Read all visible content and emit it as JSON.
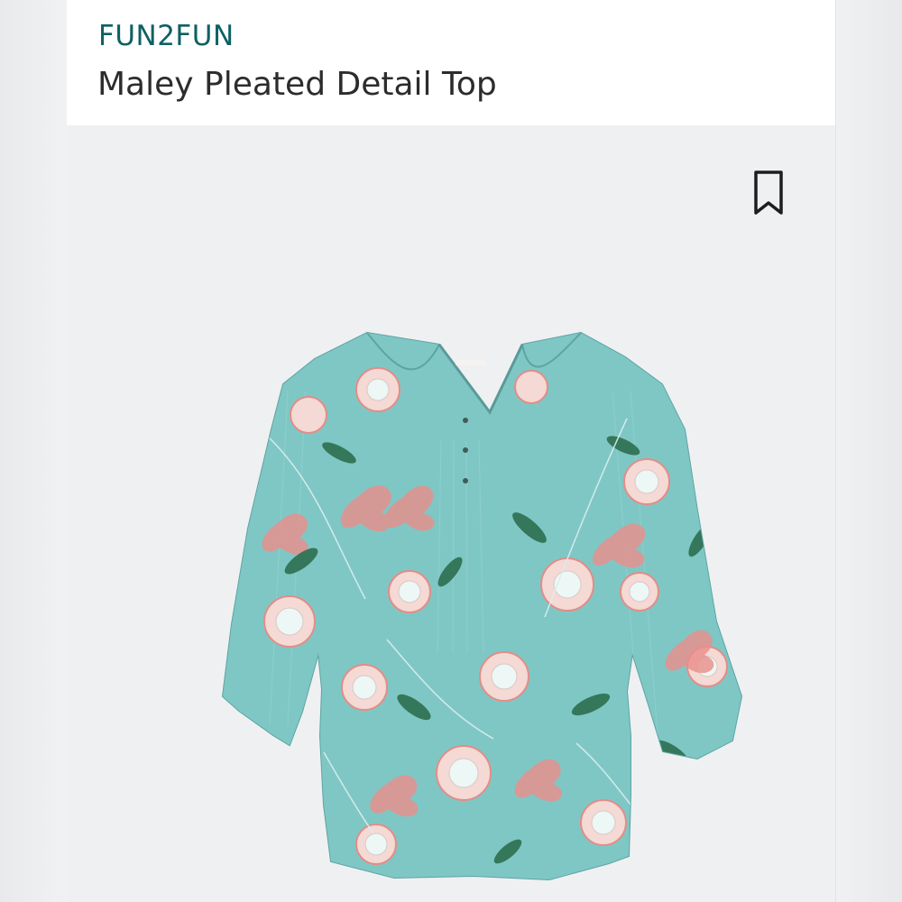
{
  "product": {
    "brand": "FUN2FUN",
    "title": "Maley Pleated Detail Top"
  },
  "icons": {
    "bookmark": "bookmark-outline-icon"
  },
  "colors": {
    "brand": "#0f6063",
    "title": "#2c2c2c",
    "garment": "#7cc4c3",
    "background": "#eff0f2"
  }
}
